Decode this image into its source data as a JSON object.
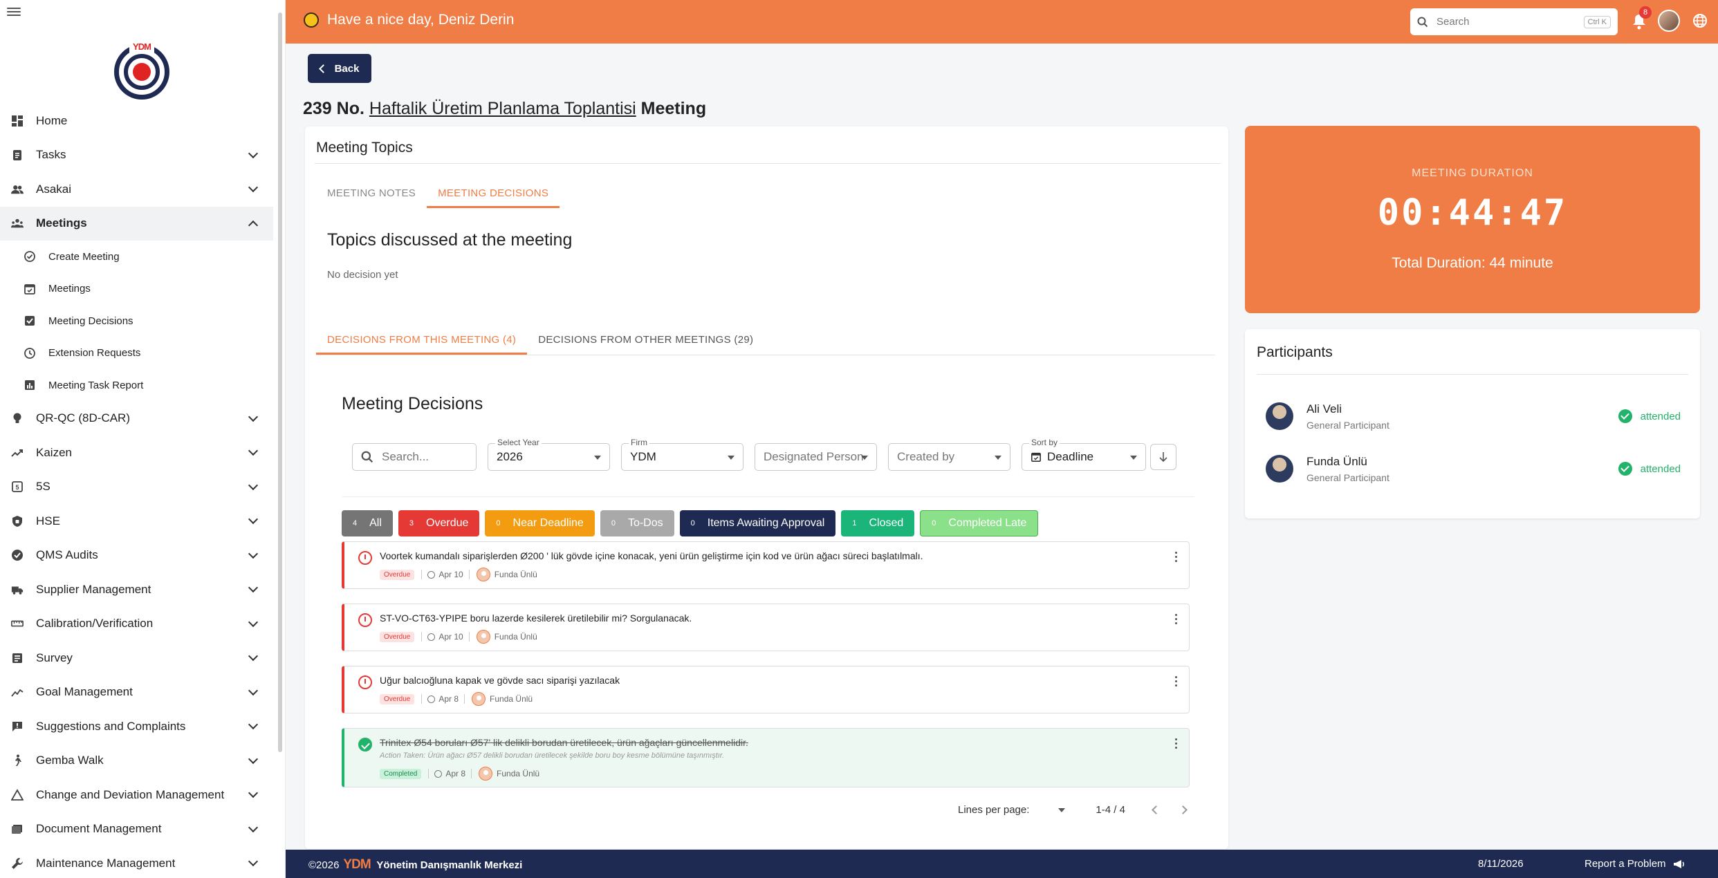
{
  "sidebar": {
    "items": [
      {
        "label": "Home",
        "icon": "dashboard-icon",
        "expandable": false
      },
      {
        "label": "Tasks",
        "icon": "clipboard-icon",
        "expandable": true
      },
      {
        "label": "Asakai",
        "icon": "people-icon",
        "expandable": true
      },
      {
        "label": "Meetings",
        "icon": "groups-icon",
        "expandable": true,
        "active": true
      },
      {
        "label": "QR-QC (8D-CAR)",
        "icon": "bulb-icon",
        "expandable": true
      },
      {
        "label": "Kaizen",
        "icon": "trend-icon",
        "expandable": true
      },
      {
        "label": "5S",
        "icon": "five-s-icon",
        "expandable": true
      },
      {
        "label": "HSE",
        "icon": "shield-icon",
        "expandable": true
      },
      {
        "label": "QMS Audits",
        "icon": "verified-icon",
        "expandable": true
      },
      {
        "label": "Supplier Management",
        "icon": "truck-icon",
        "expandable": true
      },
      {
        "label": "Calibration/Verification",
        "icon": "ruler-icon",
        "expandable": true
      },
      {
        "label": "Survey",
        "icon": "survey-icon",
        "expandable": true
      },
      {
        "label": "Goal Management",
        "icon": "chart-line-icon",
        "expandable": true
      },
      {
        "label": "Suggestions and Complaints",
        "icon": "feedback-icon",
        "expandable": true
      },
      {
        "label": "Gemba Walk",
        "icon": "walk-icon",
        "expandable": true
      },
      {
        "label": "Change and Deviation Management",
        "icon": "triangle-icon",
        "expandable": true
      },
      {
        "label": "Document Management",
        "icon": "folder-icon",
        "expandable": true
      },
      {
        "label": "Maintenance Management",
        "icon": "wrench-icon",
        "expandable": true
      }
    ],
    "meetings_sub": [
      {
        "label": "Create Meeting",
        "icon": "create-meeting-icon"
      },
      {
        "label": "Meetings",
        "icon": "calendar-icon"
      },
      {
        "label": "Meeting Decisions",
        "icon": "checkbox-icon"
      },
      {
        "label": "Extension Requests",
        "icon": "clock-icon"
      },
      {
        "label": "Meeting Task Report",
        "icon": "report-icon"
      }
    ]
  },
  "header": {
    "greeting": "Have a nice day, Deniz Derin",
    "search_placeholder": "Search",
    "search_shortcut": "Ctrl K",
    "notification_count": "8"
  },
  "page": {
    "back_label": "Back",
    "title_prefix": "239 No.",
    "title_link": "Haftalik Üretim Planlama Toplantisi",
    "title_suffix": "Meeting"
  },
  "topics": {
    "card_title": "Meeting Topics",
    "tabs": [
      "MEETING NOTES",
      "MEETING DECISIONS"
    ],
    "heading": "Topics discussed at the meeting",
    "empty_text": "No decision yet"
  },
  "decision_tabs": [
    "DECISIONS FROM THIS MEETING (4)",
    "DECISIONS FROM OTHER MEETINGS (29)"
  ],
  "decisions": {
    "title": "Meeting Decisions",
    "filters": {
      "search_placeholder": "Search...",
      "year_label": "Select Year",
      "year_value": "2026",
      "firm_label": "Firm",
      "firm_value": "YDM",
      "designated_placeholder": "Designated Person",
      "created_by_placeholder": "Created by",
      "sort_label": "Sort by",
      "sort_value": "Deadline"
    },
    "chips": [
      {
        "count": "4",
        "label": "All",
        "color": "#757575"
      },
      {
        "count": "3",
        "label": "Overdue",
        "color": "#e53935"
      },
      {
        "count": "0",
        "label": "Near Deadline",
        "color": "#f39c12"
      },
      {
        "count": "0",
        "label": "To-Dos",
        "color": "#a9a9a9"
      },
      {
        "count": "0",
        "label": "Items Awaiting Approval",
        "color": "#1f2a52"
      },
      {
        "count": "1",
        "label": "Closed",
        "color": "#1bb57a"
      },
      {
        "count": "0",
        "label": "Completed Late",
        "color": "#8be08a"
      }
    ],
    "items": [
      {
        "title": "Voortek kumandalı siparişlerden Ø200 ' lük gövde içine konacak, yeni ürün geliştirme için kod ve ürün ağacı süreci başlatılmalı.",
        "status": "Overdue",
        "date": "Apr 10",
        "person": "Funda Ünlü"
      },
      {
        "title": "ST-VO-CT63-YPIPE boru lazerde kesilerek üretilebilir mi? Sorgulanacak.",
        "status": "Overdue",
        "date": "Apr 10",
        "person": "Funda Ünlü"
      },
      {
        "title": "Uğur balcıoğluna kapak ve gövde sacı siparişi yazılacak",
        "status": "Overdue",
        "date": "Apr 8",
        "person": "Funda Ünlü"
      },
      {
        "title": "Trinitex Ø54 boruları Ø57' lik delikli borudan üretilecek, ürün ağaçları güncellenmelidir.",
        "action": "Action Taken: Ürün ağacı Ø57 delikli borudan üretilecek şekilde boru boy kesme bölümüne taşınmıştır.",
        "status": "Completed",
        "date": "Apr 8",
        "person": "Funda Ünlü"
      }
    ],
    "pager": {
      "label": "Lines per page:",
      "range": "1-4 / 4"
    }
  },
  "duration": {
    "label": "MEETING DURATION",
    "time": "00:44:47",
    "total": "Total Duration: 44 minute"
  },
  "participants": {
    "title": "Participants",
    "list": [
      {
        "name": "Ali Veli",
        "role": "General Participant",
        "status": "attended"
      },
      {
        "name": "Funda Ünlü",
        "role": "General Participant",
        "status": "attended"
      }
    ]
  },
  "footer": {
    "copyright": "©2026",
    "logo_text": "YDM",
    "company": "Yönetim Danışmanlık Merkezi",
    "date": "8/11/2026",
    "report": "Report a Problem"
  }
}
